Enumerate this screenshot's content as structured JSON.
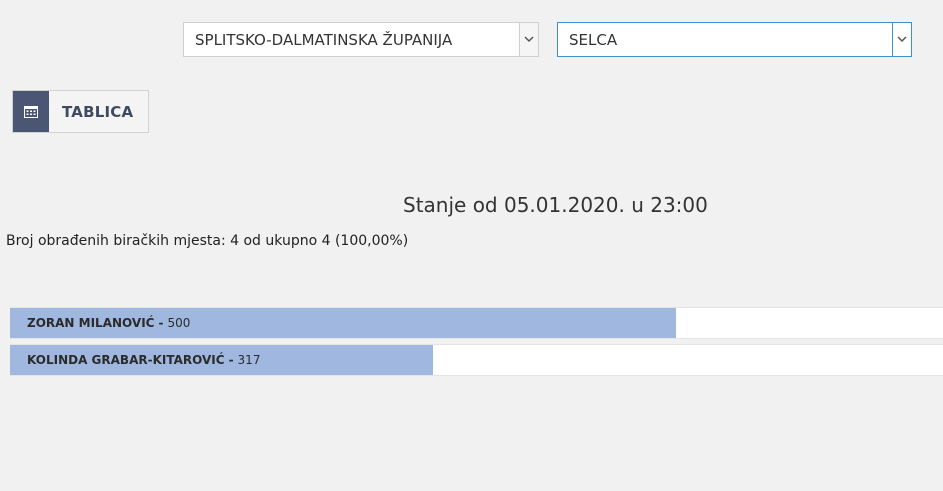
{
  "filters": {
    "county": {
      "value": "SPLITSKO-DALMATINSKA ŽUPANIJA"
    },
    "municipality": {
      "value": "SELCA"
    }
  },
  "view_tab": {
    "label": "TABLICA",
    "icon": "table-icon"
  },
  "status": {
    "title": "Stanje od 05.01.2020. u 23:00",
    "processed": "Broj obrađenih biračkih mjesta: 4 od ukupno 4 (100,00%)"
  },
  "results": {
    "max_votes": 700,
    "bar_color": "#a0b8df",
    "candidates": [
      {
        "name": "ZORAN MILANOVIĆ",
        "sep": "-",
        "votes": "500"
      },
      {
        "name": "KOLINDA GRABAR-KITAROVIĆ",
        "sep": "-",
        "votes": "317"
      }
    ]
  }
}
